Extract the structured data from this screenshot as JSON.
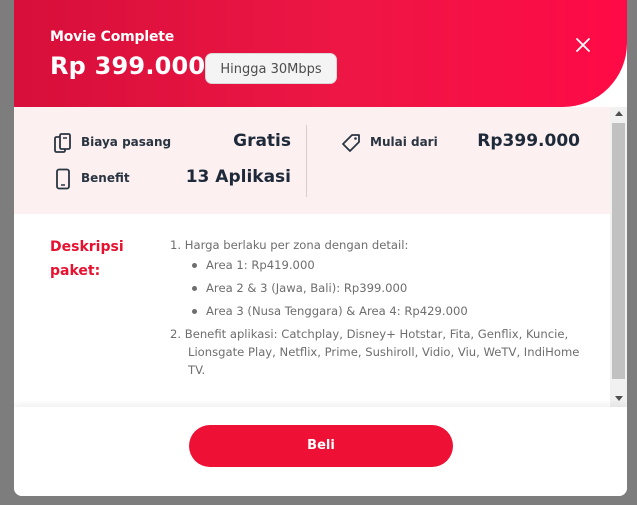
{
  "header": {
    "package_name": "Movie Complete",
    "price": "Rp 399.000",
    "speed": "Hingga 30Mbps"
  },
  "summary": {
    "install_cost": {
      "label": "Biaya pasang",
      "value": "Gratis"
    },
    "benefit": {
      "label": "Benefit",
      "value": "13 Aplikasi"
    },
    "starting_price": {
      "label": "Mulai dari",
      "value": "Rp399.000"
    }
  },
  "description": {
    "label": "Deskripsi paket:",
    "point1": "1. Harga berlaku per zona dengan detail:",
    "zones": [
      "Area 1: Rp419.000",
      "Area 2 & 3 (Jawa, Bali): Rp399.000",
      "Area 3 (Nusa Tenggara) & Area 4: Rp429.000"
    ],
    "point2": "2. Benefit aplikasi: Catchplay, Disney+ Hotstar, Fita, Genflix, Kuncie,",
    "point2_cont": "Lionsgate Play, Netflix, Prime, Sushiroll, Vidio, Viu, WeTV, IndiHome TV."
  },
  "footer": {
    "buy_label": "Beli"
  },
  "colors": {
    "accent": "#ee1135",
    "summary_bg": "#fcf0f0",
    "dark_text": "#1e2a3a"
  }
}
